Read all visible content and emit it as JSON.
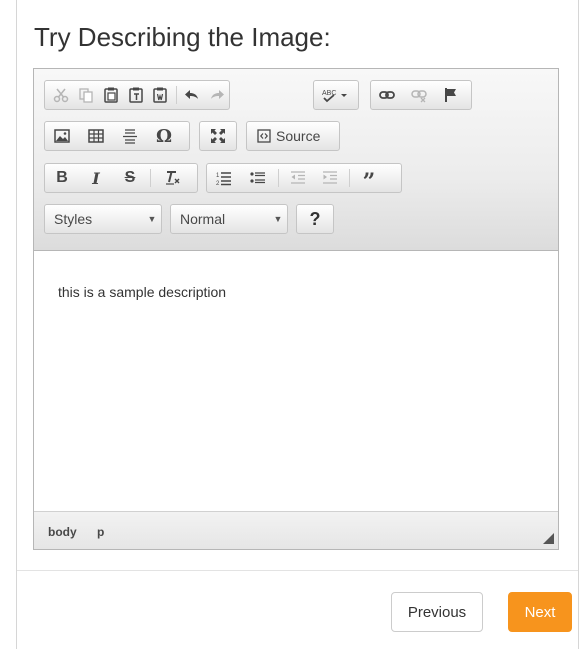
{
  "page": {
    "title": "Try Describing the Image:"
  },
  "toolbar": {
    "source_label": "Source",
    "styles_combo": "Styles",
    "format_combo": "Normal",
    "help_label": "?"
  },
  "editor": {
    "content_text": "this is a sample description",
    "path": [
      "body",
      "p"
    ]
  },
  "footer": {
    "previous_label": "Previous",
    "next_label": "Next"
  },
  "colors": {
    "accent": "#f7941d"
  }
}
